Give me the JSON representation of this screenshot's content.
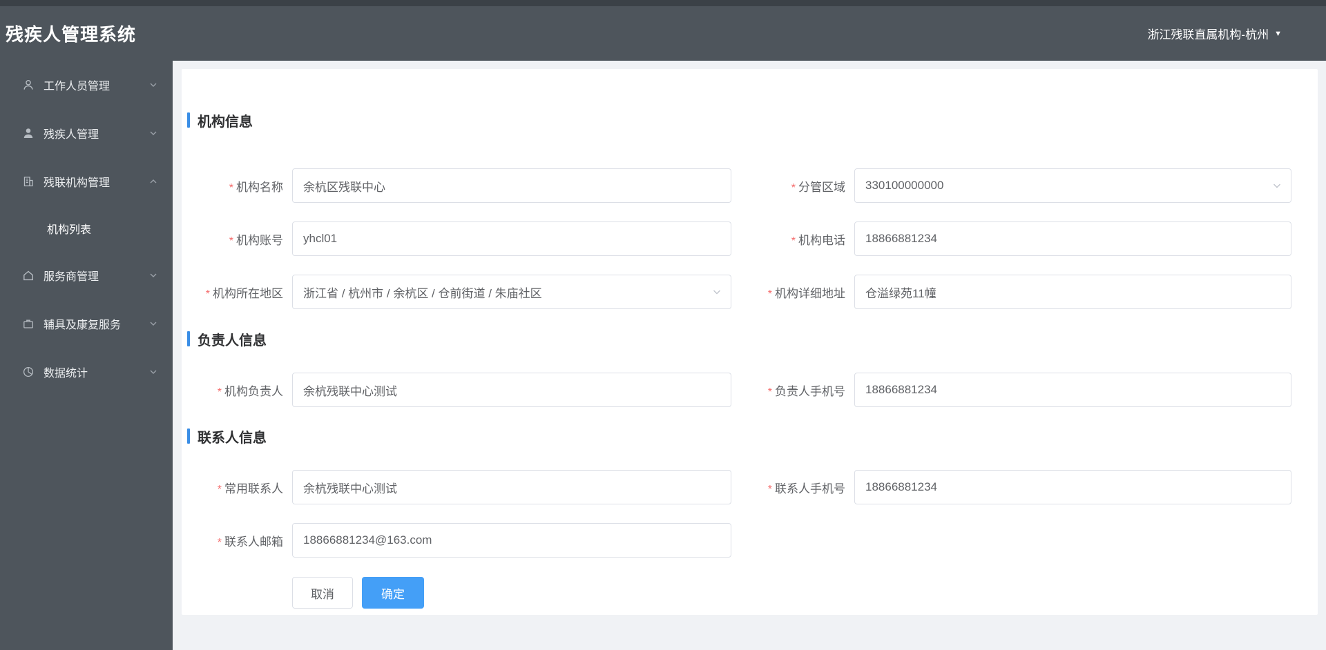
{
  "header": {
    "app_title": "残疾人管理系统",
    "user_org": "浙江残联直属机构-杭州",
    "caret": "▼"
  },
  "sidebar": {
    "items": [
      {
        "label": "工作人员管理",
        "icon": "user-outline-icon",
        "state": "collapsed"
      },
      {
        "label": "残疾人管理",
        "icon": "user-filled-icon",
        "state": "collapsed"
      },
      {
        "label": "残联机构管理",
        "icon": "building-icon",
        "state": "expanded"
      },
      {
        "label": "服务商管理",
        "icon": "home-icon",
        "state": "collapsed"
      },
      {
        "label": "辅具及康复服务",
        "icon": "briefcase-icon",
        "state": "collapsed"
      },
      {
        "label": "数据统计",
        "icon": "pie-chart-icon",
        "state": "collapsed"
      }
    ],
    "submenu": {
      "label": "机构列表"
    }
  },
  "form": {
    "required_marker": "*",
    "sections": {
      "org": "机构信息",
      "leader": "负责人信息",
      "contact": "联系人信息"
    },
    "fields": {
      "org_name": {
        "label": "机构名称",
        "value": "余杭区残联中心",
        "type": "text"
      },
      "region": {
        "label": "分管区域",
        "value": "330100000000",
        "type": "select"
      },
      "org_account": {
        "label": "机构账号",
        "value": "yhcl01",
        "type": "text"
      },
      "org_phone": {
        "label": "机构电话",
        "value": "18866881234",
        "type": "text"
      },
      "org_area": {
        "label": "机构所在地区",
        "value": "浙江省 / 杭州市 / 余杭区 / 仓前街道 / 朱庙社区",
        "type": "cascader"
      },
      "org_address": {
        "label": "机构详细地址",
        "value": "仓溢绿苑11幢",
        "type": "text"
      },
      "leader_name": {
        "label": "机构负责人",
        "value": "余杭残联中心测试",
        "type": "text"
      },
      "leader_phone": {
        "label": "负责人手机号",
        "value": "18866881234",
        "type": "text"
      },
      "contact_name": {
        "label": "常用联系人",
        "value": "余杭残联中心测试",
        "type": "text"
      },
      "contact_phone": {
        "label": "联系人手机号",
        "value": "18866881234",
        "type": "text"
      },
      "contact_email": {
        "label": "联系人邮箱",
        "value": "18866881234@163.com",
        "type": "text"
      }
    },
    "buttons": {
      "cancel": "取消",
      "confirm": "确定"
    }
  },
  "colors": {
    "header_bg": "#4e555c",
    "header_top_strip": "#3b4147",
    "page_bg": "#f0f2f5",
    "accent_blue": "#449ff7",
    "section_bar_blue": "#3a8ee6",
    "required_red": "#f56c6c",
    "input_border": "#dcdfe6",
    "label_text": "#606266",
    "title_text": "#303133"
  }
}
